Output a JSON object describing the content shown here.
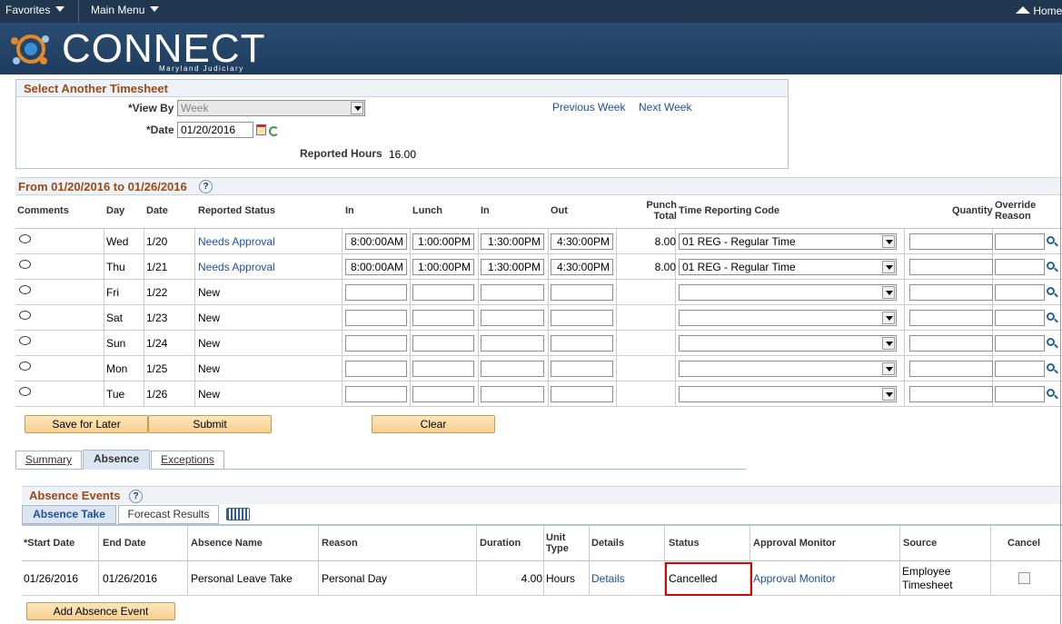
{
  "topnav": {
    "favorites": "Favorites",
    "main_menu": "Main Menu",
    "home": "Home"
  },
  "brand": {
    "name": "CONNECT",
    "sub": "Maryland Judiciary"
  },
  "select_timesheet": {
    "title": "Select Another Timesheet",
    "view_by_label": "*View By",
    "view_by_value": "Week",
    "date_label": "*Date",
    "date_value": "01/20/2016",
    "prev_week": "Previous Week",
    "next_week": "Next Week",
    "reported_hours_label": "Reported Hours",
    "reported_hours_value": "16.00"
  },
  "period": {
    "title": "From 01/20/2016 to 01/26/2016",
    "help": "?"
  },
  "grid": {
    "headers": {
      "comments": "Comments",
      "day": "Day",
      "date": "Date",
      "status": "Reported Status",
      "in1": "In",
      "lunch": "Lunch",
      "in2": "In",
      "out": "Out",
      "punch_total_1": "Punch",
      "punch_total_2": "Total",
      "trc": "Time Reporting Code",
      "quantity": "Quantity",
      "override_1": "Override",
      "override_2": "Reason"
    },
    "rows": [
      {
        "day": "Wed",
        "date": "1/20",
        "status": "Needs Approval",
        "status_link": true,
        "in1": "8:00:00AM",
        "lunch": "1:00:00PM",
        "in2": "1:30:00PM",
        "out": "4:30:00PM",
        "total": "8.00",
        "trc": "01 REG - Regular Time"
      },
      {
        "day": "Thu",
        "date": "1/21",
        "status": "Needs Approval",
        "status_link": true,
        "in1": "8:00:00AM",
        "lunch": "1:00:00PM",
        "in2": "1:30:00PM",
        "out": "4:30:00PM",
        "total": "8.00",
        "trc": "01 REG - Regular Time"
      },
      {
        "day": "Fri",
        "date": "1/22",
        "status": "New",
        "status_link": false,
        "in1": "",
        "lunch": "",
        "in2": "",
        "out": "",
        "total": "",
        "trc": ""
      },
      {
        "day": "Sat",
        "date": "1/23",
        "status": "New",
        "status_link": false,
        "in1": "",
        "lunch": "",
        "in2": "",
        "out": "",
        "total": "",
        "trc": ""
      },
      {
        "day": "Sun",
        "date": "1/24",
        "status": "New",
        "status_link": false,
        "in1": "",
        "lunch": "",
        "in2": "",
        "out": "",
        "total": "",
        "trc": ""
      },
      {
        "day": "Mon",
        "date": "1/25",
        "status": "New",
        "status_link": false,
        "in1": "",
        "lunch": "",
        "in2": "",
        "out": "",
        "total": "",
        "trc": ""
      },
      {
        "day": "Tue",
        "date": "1/26",
        "status": "New",
        "status_link": false,
        "in1": "",
        "lunch": "",
        "in2": "",
        "out": "",
        "total": "",
        "trc": ""
      }
    ]
  },
  "buttons": {
    "save_for_later": "Save for Later",
    "submit": "Submit",
    "clear": "Clear",
    "add_absence": "Add Absence Event"
  },
  "tabs": [
    "Summary",
    "Absence",
    "Exceptions"
  ],
  "absence": {
    "title": "Absence Events",
    "help": "?",
    "subtabs": [
      "Absence Take",
      "Forecast Results"
    ],
    "headers": {
      "start": "*Start Date",
      "end": "End Date",
      "name": "Absence Name",
      "reason": "Reason",
      "duration": "Duration",
      "unit_1": "Unit",
      "unit_2": "Type",
      "details": "Details",
      "status": "Status",
      "approval": "Approval Monitor",
      "source": "Source",
      "cancel": "Cancel"
    },
    "row": {
      "start": "01/26/2016",
      "end": "01/26/2016",
      "name": "Personal Leave Take",
      "reason": "Personal Day",
      "duration": "4.00",
      "unit": "Hours",
      "details": "Details",
      "status": "Cancelled",
      "approval": "Approval Monitor",
      "source_1": "Employee",
      "source_2": "Timesheet"
    }
  },
  "colors": {
    "nav": "#20374f",
    "section_title": "#9a4a16",
    "link": "#1d4f9b",
    "highlight": "#e00000"
  }
}
